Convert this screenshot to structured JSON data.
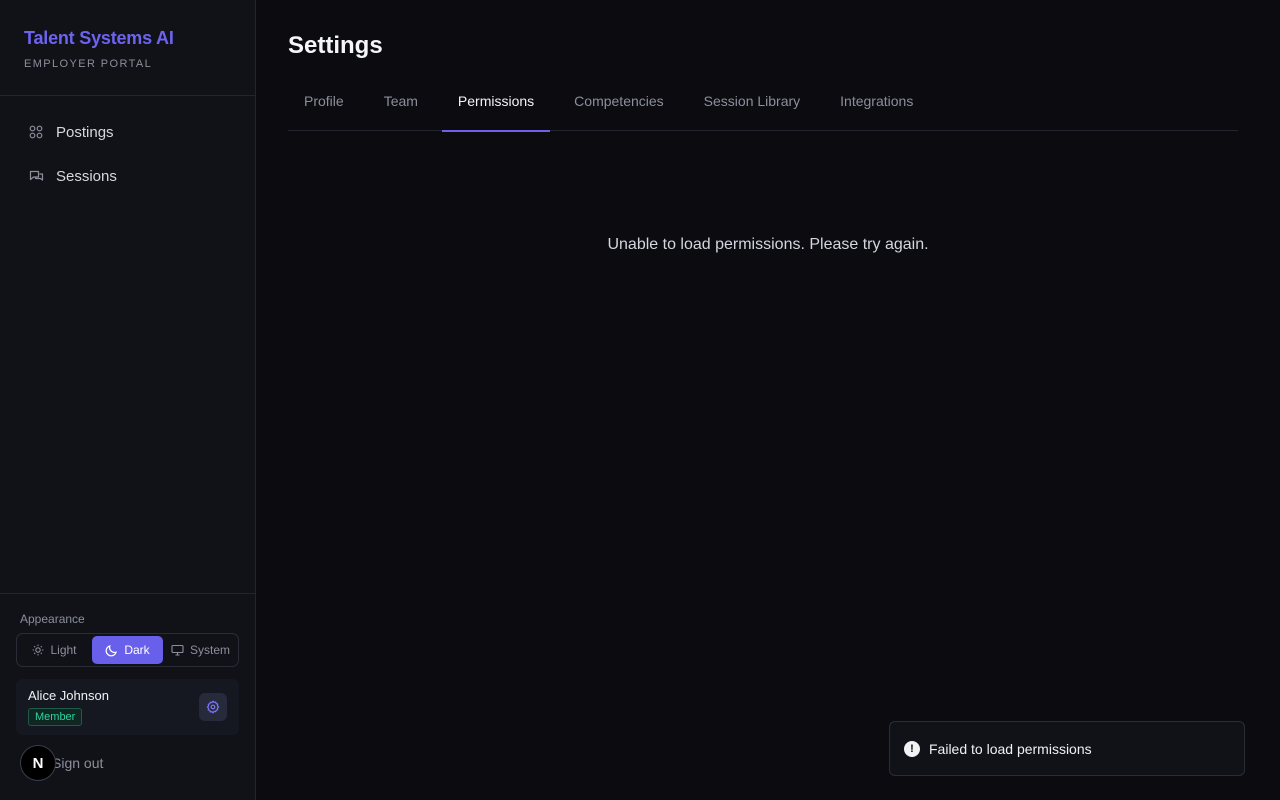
{
  "brand": {
    "title": "Talent Systems AI",
    "subtitle": "EMPLOYER PORTAL"
  },
  "sidebar": {
    "items": [
      {
        "label": "Postings",
        "icon": "grid-icon"
      },
      {
        "label": "Sessions",
        "icon": "chat-icon"
      }
    ]
  },
  "appearance": {
    "label": "Appearance",
    "options": [
      {
        "label": "Light",
        "icon": "sun-icon"
      },
      {
        "label": "Dark",
        "icon": "moon-icon",
        "selected": true
      },
      {
        "label": "System",
        "icon": "monitor-icon"
      }
    ]
  },
  "user": {
    "name": "Alice Johnson",
    "role": "Member"
  },
  "signout": {
    "label": "Sign out",
    "badge": "N"
  },
  "page": {
    "title": "Settings"
  },
  "tabs": [
    {
      "label": "Profile"
    },
    {
      "label": "Team"
    },
    {
      "label": "Permissions",
      "active": true
    },
    {
      "label": "Competencies"
    },
    {
      "label": "Session Library"
    },
    {
      "label": "Integrations"
    }
  ],
  "content": {
    "error": "Unable to load permissions. Please try again."
  },
  "toast": {
    "message": "Failed to load permissions"
  },
  "colors": {
    "accent": "#6c63ec",
    "background": "#0b0b10",
    "sidebar": "#111218",
    "role_badge": "#2dd4a4"
  }
}
